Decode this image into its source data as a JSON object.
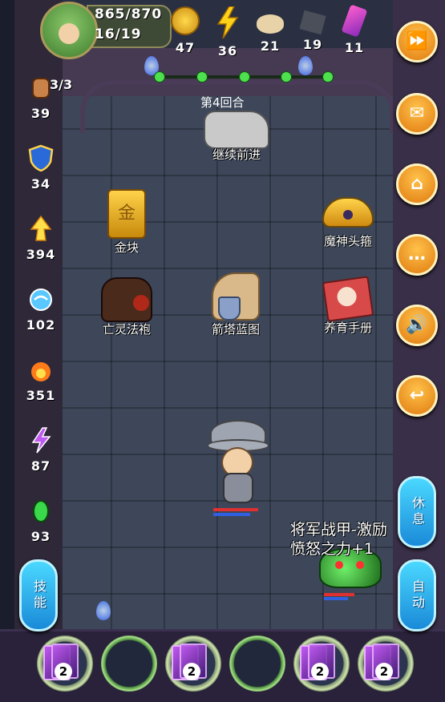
{
  "header": {
    "hp": "865/870",
    "floor": "16/19"
  },
  "resources": [
    {
      "icon": "gold-coin-icon",
      "value": "47"
    },
    {
      "icon": "lightning-icon",
      "value": "36"
    },
    {
      "icon": "bread-icon",
      "value": "21"
    },
    {
      "icon": "ore-icon",
      "value": "19"
    },
    {
      "icon": "crystal-icon",
      "value": "11"
    }
  ],
  "left_stats": [
    {
      "icon": "fist-icon",
      "value": "39"
    },
    {
      "icon": "shield-icon",
      "value": "34"
    },
    {
      "icon": "flame-arrow-icon",
      "value": "394"
    },
    {
      "icon": "wind-icon",
      "value": "102"
    },
    {
      "icon": "fire-icon",
      "value": "351"
    },
    {
      "icon": "lightning-strike-icon",
      "value": "87"
    },
    {
      "icon": "poison-icon",
      "value": "93"
    }
  ],
  "counter": "3/3",
  "round_label": "第4回合",
  "progress_steps": 5,
  "items": {
    "continue": "继续前进",
    "gold": "金块",
    "gold_glyph": "金",
    "circlet": "魔神头箍",
    "cloak": "亡灵法袍",
    "blueprint": "箭塔蓝图",
    "handbook": "养育手册"
  },
  "float_text": {
    "line1": "将军战甲-激励",
    "line2": "愤怒之力+1"
  },
  "buttons": {
    "skill": "技能",
    "rest": "休息",
    "auto": "自动",
    "fast_forward": "⏩",
    "mail": "✉",
    "home": "⌂",
    "chat": "…",
    "sound": "🔊",
    "back": "↩"
  },
  "skill_slots": [
    {
      "type": "card",
      "count": "2"
    },
    {
      "type": "empty"
    },
    {
      "type": "card",
      "count": "2"
    },
    {
      "type": "empty"
    },
    {
      "type": "card",
      "count": "2"
    },
    {
      "type": "card",
      "count": "2"
    }
  ],
  "colors": {
    "accent": "#f0a020",
    "pill": "#2aa8ec",
    "hp_red": "#e03030",
    "mp_blue": "#3060e0"
  }
}
